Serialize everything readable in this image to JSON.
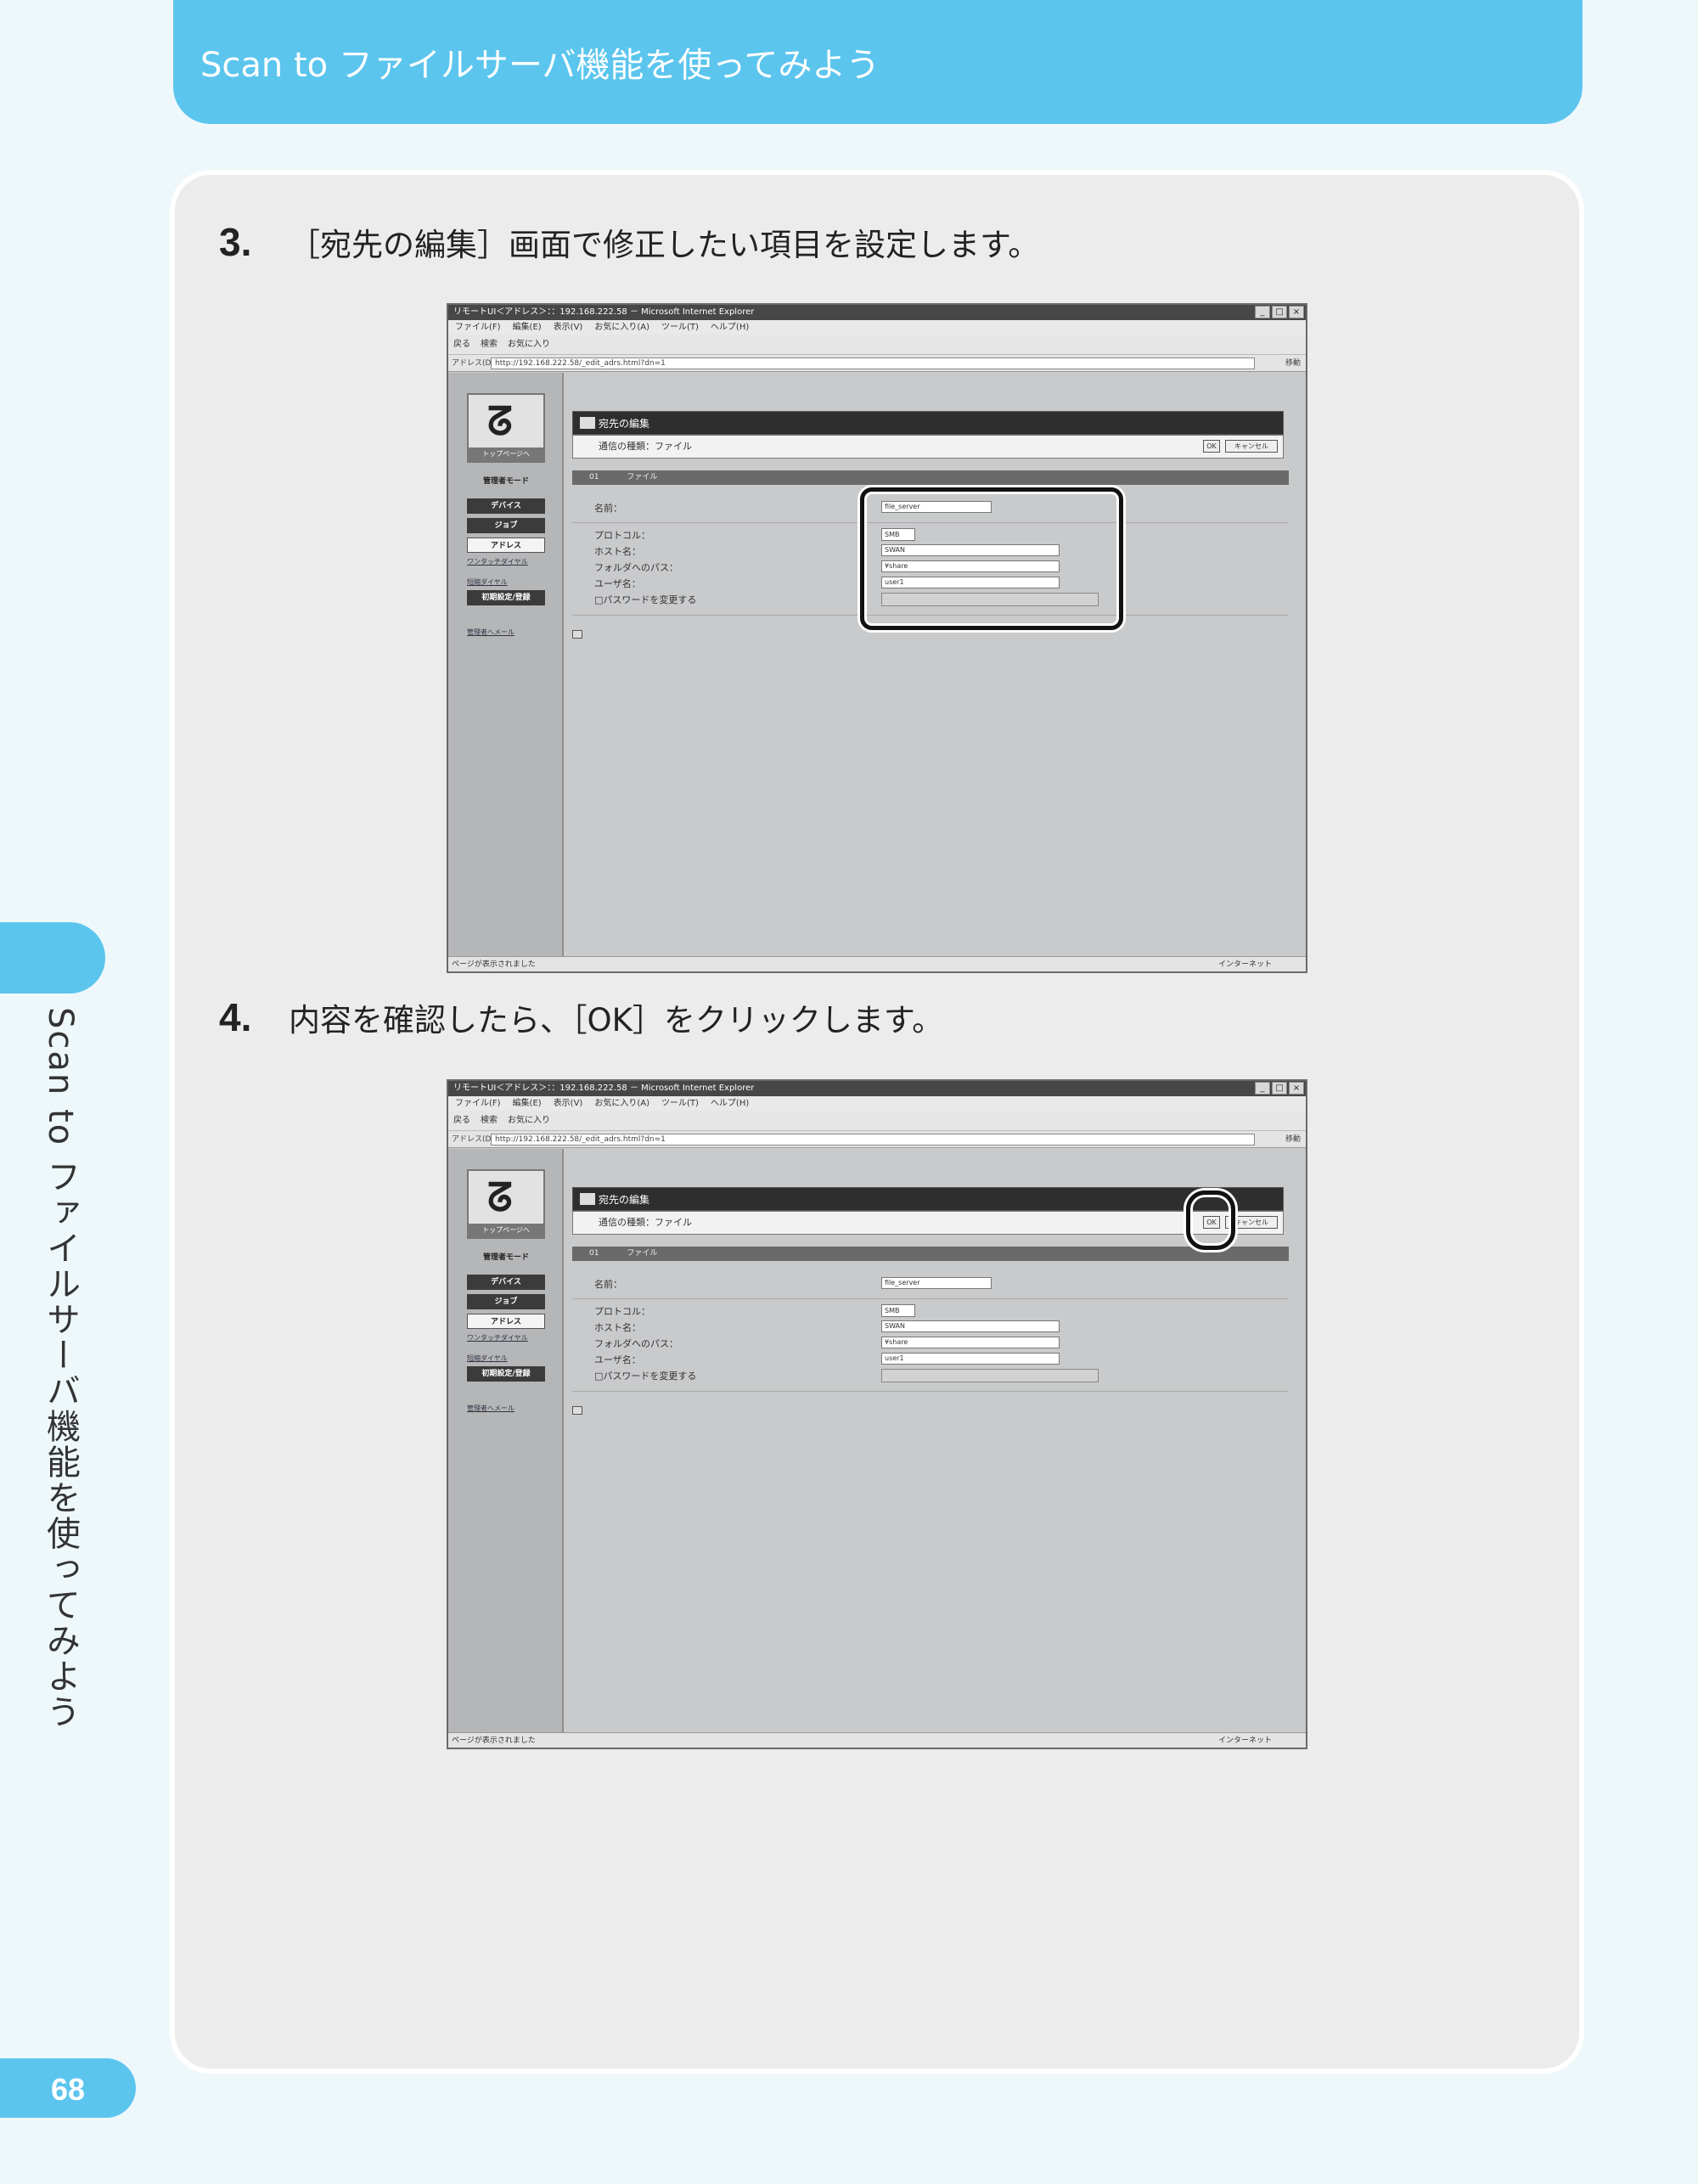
{
  "header": {
    "title": "Scan to ファイルサーバ機能を使ってみよう"
  },
  "side": {
    "vertical_title": "Scan to ファイルサーバ機能を使ってみよう",
    "page_number": "68"
  },
  "steps": [
    {
      "number": "3.",
      "text": "［宛先の編集］画面で修正したい項目を設定します。"
    },
    {
      "number": "4.",
      "text": "内容を確認したら、［OK］をクリックします。"
    }
  ],
  "browser": {
    "window_title": "リモートUI＜アドレス＞：：192.168.222.58 － Microsoft Internet Explorer",
    "window_buttons": [
      "_",
      "□",
      "×"
    ],
    "menu": [
      "ファイル(F)",
      "編集(E)",
      "表示(V)",
      "お気に入り(A)",
      "ツール(T)",
      "ヘルプ(H)"
    ],
    "toolbar": [
      "戻る",
      "検索",
      "お気に入り"
    ],
    "address_label": "アドレス(D)",
    "address_url": "http://192.168.222.58/_edit_adrs.html?dn=1",
    "go_label": "移動",
    "status_left": "ページが表示されました",
    "status_zone": "インターネット"
  },
  "sidebar": {
    "logo_label": "トップページへ",
    "mode_label": "管理者モード",
    "nav": [
      "デバイス",
      "ジョブ",
      "アドレス"
    ],
    "links": [
      "ワンタッチダイヤル",
      "短縮ダイヤル"
    ],
    "initial_button": "初期設定/登録",
    "mail_link": "管理者へメール"
  },
  "dialog": {
    "title": "宛先の編集",
    "type_line": "通信の種類：ファイル",
    "ok_label": "OK",
    "cancel_label": "キャンセル",
    "section_number": "01",
    "section_type": "ファイル",
    "fields": {
      "name_label": "名前：",
      "name_value": "file_server",
      "protocol_label": "プロトコル：",
      "protocol_value": "SMB",
      "host_label": "ホスト名：",
      "host_value": "SWAN",
      "path_label": "フォルダへのパス：",
      "path_value": "¥share",
      "user_label": "ユーザ名：",
      "user_value": "user1",
      "password_label": "□パスワードを変更する"
    }
  }
}
